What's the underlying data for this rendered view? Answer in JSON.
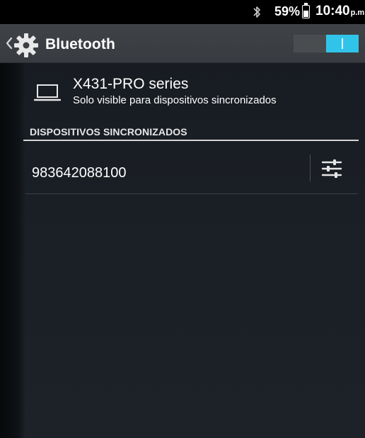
{
  "status_bar": {
    "battery_percent": "59%",
    "battery_level": 0.59,
    "time": "10:40",
    "ampm": "p.m",
    "bluetooth_icon": "bluetooth-icon",
    "battery_icon": "battery-icon"
  },
  "action_bar": {
    "title": "Bluetooth",
    "back_icon": "chevron-left-icon",
    "app_icon": "gear-icon",
    "toggle_on": true,
    "toggle_color": "#31c4ea"
  },
  "own_device": {
    "icon": "laptop-icon",
    "name": "X431-PRO series",
    "visibility": "Solo visible para dispositivos sincronizados"
  },
  "paired_section": {
    "header": "DISPOSITIVOS SINCRONIZADOS",
    "devices": [
      {
        "name": "983642088100",
        "settings_icon": "sliders-icon"
      }
    ]
  },
  "colors": {
    "accent": "#31c4ea",
    "action_bar": "#3c4044",
    "background": "#1a1f25",
    "divider": "#d4d4d4"
  }
}
